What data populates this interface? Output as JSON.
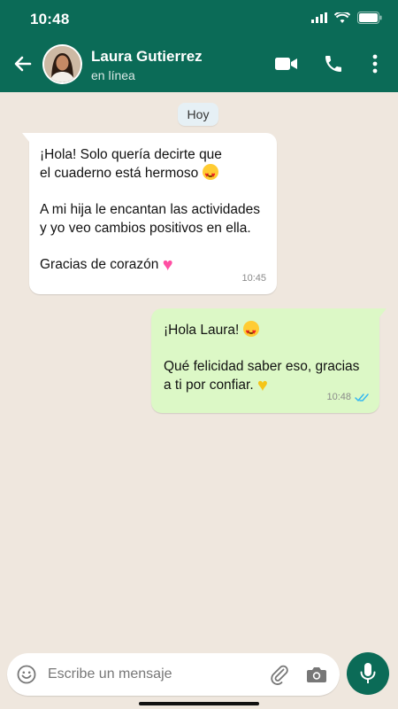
{
  "status_bar": {
    "time": "10:48"
  },
  "contact": {
    "name": "Laura Gutierrez",
    "status": "en línea"
  },
  "chat": {
    "date_chip": "Hoy",
    "messages": [
      {
        "direction": "incoming",
        "lines": [
          "¡Hola! Solo quería decirte que",
          "el cuaderno está hermoso",
          "A mi hija le encantan las actividades",
          "y yo veo cambios positivos en ella.",
          "Gracias de corazón"
        ],
        "time": "10:45"
      },
      {
        "direction": "outgoing",
        "lines": [
          "¡Hola Laura!",
          "Qué felicidad saber eso, gracias",
          "a ti por confiar."
        ],
        "time": "10:48",
        "receipt": "read"
      }
    ]
  },
  "composer": {
    "placeholder": "Escribe un mensaje"
  },
  "icons": [
    "back-arrow-icon",
    "video-call-icon",
    "phone-icon",
    "more-vert-icon",
    "emoji-icon",
    "paperclip-icon",
    "camera-icon",
    "microphone-icon"
  ],
  "colors": {
    "header": "#0b6b57",
    "outgoing_bubble": "#dcf8c6",
    "incoming_bubble": "#ffffff",
    "chat_background": "#efe7de",
    "read_receipt": "#34b7f1"
  }
}
